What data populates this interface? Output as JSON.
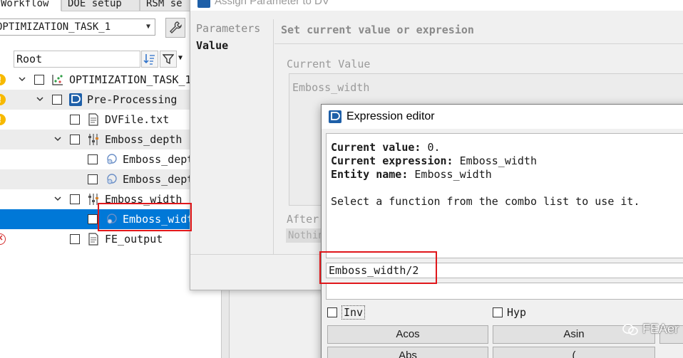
{
  "left_panel": {
    "tabs": [
      "Workflow",
      "DOE setup",
      "RSM se"
    ],
    "task_combo": "OPTIMIZATION_TASK_1",
    "root_label": "Root",
    "tree": [
      {
        "label": "OPTIMIZATION_TASK_1",
        "icon": "task-chart-icon",
        "status": "warning",
        "depth": 0,
        "expanded": true
      },
      {
        "label": "Pre-Processing",
        "icon": "app-logo-icon",
        "status": "warning",
        "depth": 1,
        "expanded": true
      },
      {
        "label": "DVFile.txt",
        "icon": "document-icon",
        "status": "warning",
        "depth": 2,
        "expanded": null
      },
      {
        "label": "Emboss_depth",
        "icon": "sliders-icon",
        "status": "",
        "depth": 2,
        "expanded": true
      },
      {
        "label": "Emboss_depth",
        "icon": "parameter-icon",
        "status": "",
        "depth": 3,
        "expanded": null
      },
      {
        "label": "Emboss_depth",
        "icon": "parameter-icon",
        "status": "",
        "depth": 3,
        "expanded": null
      },
      {
        "label": "Emboss_width",
        "icon": "sliders-icon",
        "status": "",
        "depth": 2,
        "expanded": true
      },
      {
        "label": "Emboss_width",
        "icon": "parameter-icon",
        "status": "",
        "depth": 3,
        "expanded": null,
        "selected": true
      },
      {
        "label": "FE_output",
        "icon": "document-icon",
        "status": "error",
        "depth": 2,
        "expanded": null
      }
    ]
  },
  "assign_dialog": {
    "title": "Assign Parameter to DV",
    "nav": [
      "Parameters",
      "Value"
    ],
    "section_title": "Set current value or expresion",
    "current_value_label": "Current Value",
    "current_value": "Emboss_width",
    "after_label": "After",
    "after_value": "Nothing"
  },
  "expression_editor": {
    "title": "Expression editor",
    "current_value_key": "Current value:",
    "current_value": "0.",
    "current_expression_key": "Current expression:",
    "current_expression": "Emboss_width",
    "entity_name_key": "Entity name:",
    "entity_name": "Emboss_width",
    "hint": "Select a function from the combo list to use it.",
    "expression_input": "Emboss_width/2",
    "inv_label": "Inv",
    "hyp_label": "Hyp",
    "functions_row1": [
      "Acos",
      "Asin"
    ],
    "functions_row2": [
      "Abs",
      "("
    ]
  },
  "watermark": "FEAer",
  "colors": {
    "highlight": "#e0171b",
    "selection": "#0078d7",
    "warning": "#f7b900",
    "error": "#d32f2f"
  }
}
